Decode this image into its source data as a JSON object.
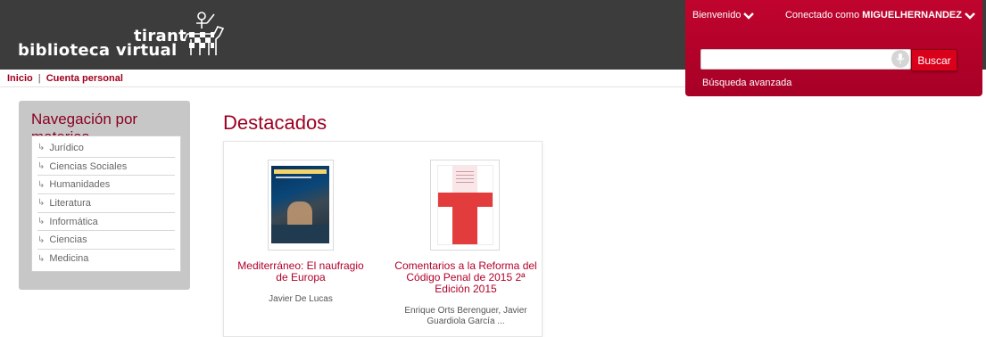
{
  "header": {
    "logo_line1": "tirant",
    "logo_line2": "biblioteca virtual"
  },
  "user_panel": {
    "welcome": "Bienvenido",
    "connected_prefix": "Conectado como",
    "username": "MIGUELHERNANDEZ",
    "search_value": "",
    "search_button": "Buscar",
    "advanced_search": "Búsqueda avanzada"
  },
  "breadcrumb": {
    "home": "Inicio",
    "separator": "|",
    "account": "Cuenta personal"
  },
  "nav": {
    "title": "Navegación por materias",
    "items": [
      {
        "label": "Jurídico"
      },
      {
        "label": "Ciencias Sociales"
      },
      {
        "label": "Humanidades"
      },
      {
        "label": "Literatura"
      },
      {
        "label": "Informática"
      },
      {
        "label": "Ciencias"
      },
      {
        "label": "Medicina"
      }
    ]
  },
  "featured": {
    "title": "Destacados",
    "books": [
      {
        "title": "Mediterráneo: El naufragio de Europa",
        "author": "Javier De Lucas"
      },
      {
        "title": "Comentarios a la Reforma del Código Penal de 2015 2ª Edición 2015",
        "author": "Enrique Orts Berenguer, Javier Guardiola García ..."
      }
    ]
  },
  "colors": {
    "header_bg": "#3c3c3c",
    "accent_red": "#b1002a",
    "nav_panel": "#c7c7c7"
  }
}
